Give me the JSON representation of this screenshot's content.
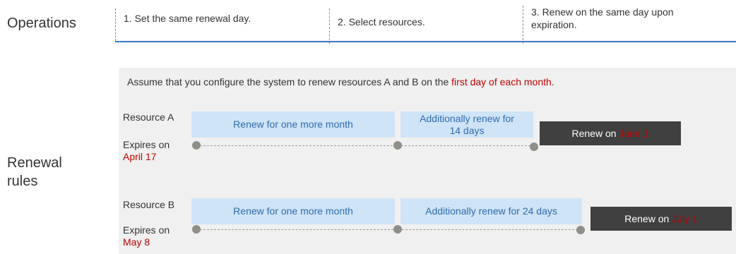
{
  "sections": {
    "operations": "Operations",
    "renewal_rules_line1": "Renewal",
    "renewal_rules_line2": "rules"
  },
  "steps": [
    {
      "line1": "1. Set the same renewal day.",
      "line2": ""
    },
    {
      "line1": "2. Select resources.",
      "line2": ""
    },
    {
      "line1": "3. Renew on the same day upon",
      "line2": "expiration."
    }
  ],
  "assumption": {
    "prefix": "Assume that you configure the system to renew resources A and B on the ",
    "highlight": "first day of each month",
    "suffix": "."
  },
  "resources": [
    {
      "name": "Resource A",
      "expires_label": "Expires on",
      "expires_date": "April 17",
      "renew_box": "Renew for one more month",
      "additional_line1": "Additionally renew for",
      "additional_line2": "14 days",
      "renew_on_prefix": "Renew on ",
      "renew_on_date": "June 1"
    },
    {
      "name": "Resource B",
      "expires_label": "Expires on",
      "expires_date": "May 8",
      "renew_box": "Renew for one more month",
      "additional_line1": "Additionally renew for 24 days",
      "additional_line2": "",
      "renew_on_prefix": "Renew on ",
      "renew_on_date": "July 1"
    }
  ],
  "colors": {
    "accent_blue": "#3b78c5",
    "box_blue": "#cfe4f7",
    "box_text_blue": "#2e6cb0",
    "highlight_red": "#c00000",
    "dark_box": "#404040",
    "panel_gray": "#f0f0f0",
    "dot_gray": "#8f8f8a"
  }
}
